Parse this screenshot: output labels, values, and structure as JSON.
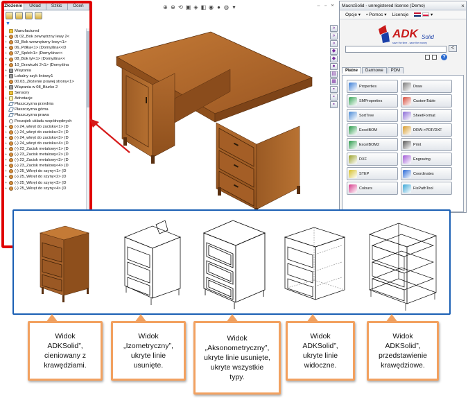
{
  "feature_tree": {
    "tabs": [
      "Złożenie",
      "Układ",
      "Szkic",
      "Oceń"
    ],
    "active_tab": "Złożenie",
    "items": [
      {
        "label": "Manufactured",
        "icon": "folder-icon",
        "expand": ""
      },
      {
        "label": "(f) 02_Bok zewnętrzny lewy 2<",
        "icon": "part-icon",
        "expand": "+"
      },
      {
        "label": "03_Bok wewnętrzny lewy<1>",
        "icon": "part-icon",
        "expand": "+"
      },
      {
        "label": "06_Półka<1> (Domyślna<<D",
        "icon": "part-icon",
        "expand": "+"
      },
      {
        "label": "07_Spód<1> (Domyślna<<",
        "icon": "part-icon",
        "expand": "+"
      },
      {
        "label": "08_Bok tył<1> (Domyślna<<",
        "icon": "part-icon",
        "expand": "+"
      },
      {
        "label": "10_Drzwiczki 2<1> (Domyślna",
        "icon": "part-icon",
        "expand": "+"
      },
      {
        "label": "Wiązania",
        "icon": "mate-icon",
        "expand": "+"
      },
      {
        "label": "Lokalny szyk liniowy1",
        "icon": "pattern-icon",
        "expand": "+"
      },
      {
        "label": "00.03_Złożenie prawej strony<1>",
        "icon": "assembly-icon",
        "expand": "-"
      },
      {
        "label": "Wiązania w 08_Biurko 2",
        "icon": "mate-icon",
        "expand": "+"
      },
      {
        "label": "Sensory",
        "icon": "folder-icon",
        "expand": ""
      },
      {
        "label": "Adnotacje",
        "icon": "note-icon",
        "expand": "+"
      },
      {
        "label": "Płaszczyzna przednia",
        "icon": "plane-icon",
        "expand": ""
      },
      {
        "label": "Płaszczyzna górna",
        "icon": "plane-icon",
        "expand": ""
      },
      {
        "label": "Płaszczyzna prawa",
        "icon": "plane-icon",
        "expand": ""
      },
      {
        "label": "Początek układu współrzędnych",
        "icon": "origin-icon",
        "expand": ""
      },
      {
        "label": "(-) 24_wkręt do zacisku<1> (D",
        "icon": "part-icon",
        "expand": "+"
      },
      {
        "label": "(-) 24_wkręt do zacisku<2> (D",
        "icon": "part-icon",
        "expand": "+"
      },
      {
        "label": "(-) 24_wkręt do zacisku<3> (D",
        "icon": "part-icon",
        "expand": "+"
      },
      {
        "label": "(-) 24_wkręt do zacisku<4> (D",
        "icon": "part-icon",
        "expand": "+"
      },
      {
        "label": "(-) 23_Zacisk metalowy<1> (D",
        "icon": "part-icon",
        "expand": "+"
      },
      {
        "label": "(-) 23_Zacisk metalowy<2> (D",
        "icon": "part-icon",
        "expand": "+"
      },
      {
        "label": "(-) 23_Zacisk metalowy<3> (D",
        "icon": "part-icon",
        "expand": "+"
      },
      {
        "label": "(-) 23_Zacisk metalowy<4> (D",
        "icon": "part-icon",
        "expand": "+"
      },
      {
        "label": "(-) 25_Wkręt do szyny<1> (D",
        "icon": "part-icon",
        "expand": "+"
      },
      {
        "label": "(-) 25_Wkręt do szyny<2> (D",
        "icon": "part-icon",
        "expand": "+"
      },
      {
        "label": "(-) 25_Wkręt do szyny<3> (D",
        "icon": "part-icon",
        "expand": "+"
      },
      {
        "label": "(-) 25_Wkręt do szyny<4> (D",
        "icon": "part-icon",
        "expand": "+"
      }
    ]
  },
  "macrosolid": {
    "title": "MacroSolid - unregistered license (Demo)",
    "menu": [
      "Opcje",
      "Pomoc",
      "Licencje"
    ],
    "logo_text": "ADK",
    "logo_sub": "Solid",
    "logo_tagline": "save the time - save the money",
    "search_button": "<",
    "help": "?",
    "tabs": [
      "Płatne",
      "Darmowe",
      "PDM"
    ],
    "active_tab": "Płatne",
    "buttons": [
      {
        "label": "Properties",
        "icon": "properties-icon"
      },
      {
        "label": "Draw",
        "icon": "draw-icon"
      },
      {
        "label": "SMProperties",
        "icon": "sm-properties-icon"
      },
      {
        "label": "CustomTable",
        "icon": "custom-table-icon"
      },
      {
        "label": "SortTree",
        "icon": "sort-tree-icon"
      },
      {
        "label": "SheetFormat",
        "icon": "sheet-format-icon"
      },
      {
        "label": "ExcelBOM",
        "icon": "excel-bom-icon"
      },
      {
        "label": "DRW->PDF/DXF",
        "icon": "drw-pdf-icon"
      },
      {
        "label": "ExcelBOM2",
        "icon": "excel-bom2-icon"
      },
      {
        "label": "Print",
        "icon": "print-icon"
      },
      {
        "label": "DXF",
        "icon": "dxf-icon"
      },
      {
        "label": "Engraving",
        "icon": "engraving-icon"
      },
      {
        "label": "STEP",
        "icon": "step-icon"
      },
      {
        "label": "Coordinates",
        "icon": "coordinates-icon"
      },
      {
        "label": "Colours",
        "icon": "colours-icon"
      },
      {
        "label": "FixPathTool",
        "icon": "fix-path-icon"
      }
    ]
  },
  "callouts": [
    {
      "text": "Widok\nADKSolid”,\ncieniowany z\nkrawędziami."
    },
    {
      "text": "Widok\n„Izometryczny”,\nukryte linie\nusunięte."
    },
    {
      "text": "Widok\n„Aksonometryczny”,\nukryte linie usunięte,\nukryte wszystkie\ntypy."
    },
    {
      "text": "Widok\nADKSolid”,\nukryte linie\nwidoczne."
    },
    {
      "text": "Widok\nADKSolid”,\nprzedstawienie\nkrawędziowe."
    }
  ],
  "colors": {
    "highlight_frame": "#e00000",
    "views_border": "#1a5fb4",
    "callout_border": "#f2a160",
    "wood": "#a8642a"
  }
}
